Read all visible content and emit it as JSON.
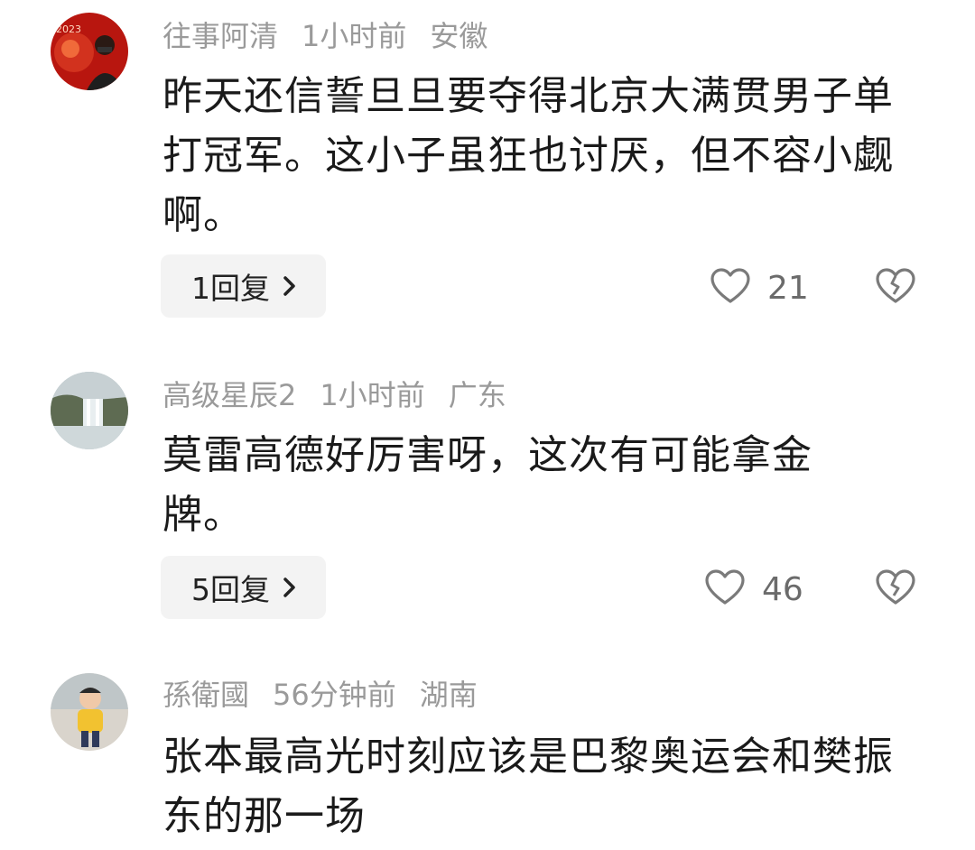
{
  "comments": [
    {
      "username": "往事阿清",
      "time": "1小时前",
      "location": "安徽",
      "text": "昨天还信誓旦旦要夺得北京大满贯男子单打冠军。这小子虽狂也讨厌，但不容小觑啊。",
      "reply_label": "1回复",
      "likes": "21",
      "avatar_icon": "rabbit-2023-avatar"
    },
    {
      "username": "高级星辰2",
      "time": "1小时前",
      "location": "广东",
      "text": "莫雷高德好厉害呀，这次有可能拿金牌。",
      "reply_label": "5回复",
      "likes": "46",
      "avatar_icon": "waterfall-avatar"
    },
    {
      "username": "孫衛國",
      "time": "56分钟前",
      "location": "湖南",
      "text": "张本最高光时刻应该是巴黎奥运会和樊振东的那一场",
      "avatar_icon": "child-photo-avatar"
    }
  ],
  "colors": {
    "meta": "#9a9a9a",
    "text": "#1a1a1a",
    "reply_bg": "#f3f3f3",
    "icon": "#7a7a7a"
  }
}
